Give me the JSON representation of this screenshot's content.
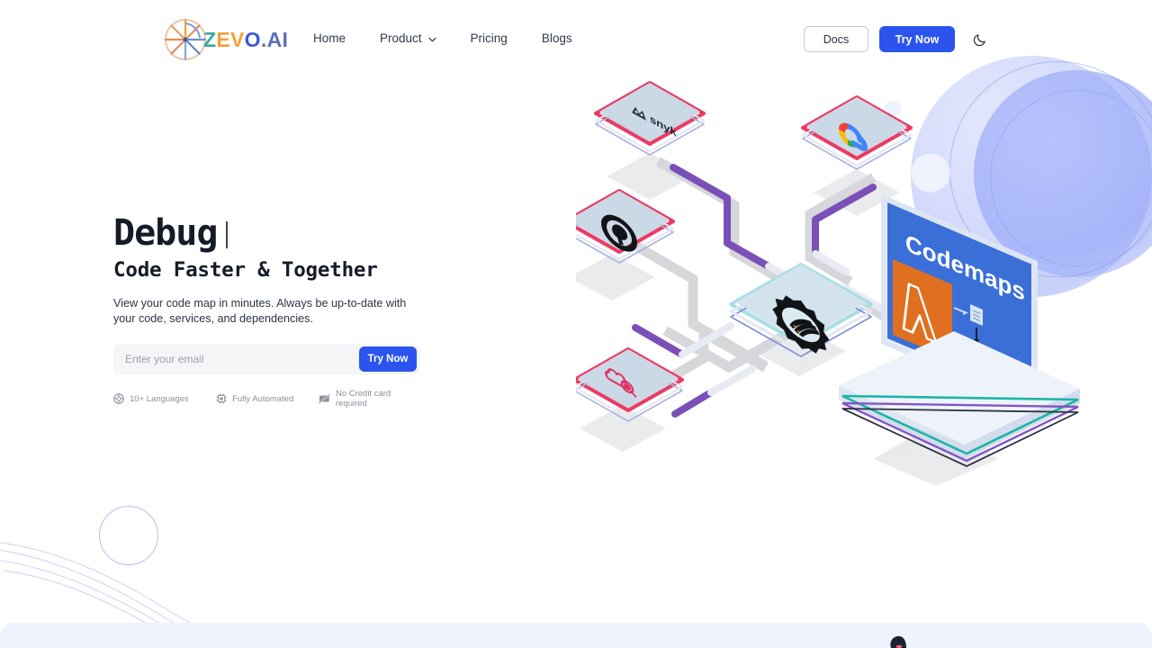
{
  "brand": {
    "name": "ZEVO.AI",
    "logo_icon": "zevo-wheel-logo",
    "parts": {
      "z": "Z",
      "e": "E",
      "v": "V",
      "o": "O",
      "dot": ".",
      "ai": "AI"
    }
  },
  "nav": {
    "links": [
      {
        "label": "Home",
        "has_dropdown": false
      },
      {
        "label": "Product",
        "has_dropdown": true,
        "icon": "chevron-down-icon"
      },
      {
        "label": "Pricing",
        "has_dropdown": false
      },
      {
        "label": "Blogs",
        "has_dropdown": false
      }
    ],
    "docs_label": "Docs",
    "try_now_label": "Try Now",
    "theme_icon": "moon-icon"
  },
  "hero": {
    "headline_typed": "Debug",
    "headline_sub": "Code Faster & Together",
    "subcopy": "View your code map in minutes. Always be up-to-date with your code, services, and dependencies.",
    "email_placeholder": "Enter your email",
    "email_value": "",
    "cta_label": "Try Now",
    "badges": [
      {
        "label": "10+ Languages",
        "icon": "globe-icon"
      },
      {
        "label": "Fully Automated",
        "icon": "chip-icon"
      },
      {
        "label": "No Credit card required",
        "icon": "no-credit-card-icon"
      }
    ]
  },
  "illustration": {
    "screen_title": "Codemaps",
    "cards": [
      {
        "name": "snyk-card",
        "label": "snyk",
        "accent": "#ec3a63"
      },
      {
        "name": "google-cloud-card",
        "label": "Google Cloud",
        "accent": "#ec3a63"
      },
      {
        "name": "github-card",
        "label": "GitHub",
        "accent": "#ec3a63"
      },
      {
        "name": "datadog-card",
        "label": "Datadog",
        "accent": "#ec3a63"
      },
      {
        "name": "gear-card",
        "label": "Build Gear",
        "accent": "#a9dfe4"
      }
    ]
  },
  "colors": {
    "accent_blue": "#2b54ef",
    "card_accent_pink": "#ec3a63",
    "connector_purple": "#7a50b8",
    "screen_blue": "#3a6fd8",
    "lambda_orange": "#e0701f",
    "text_dark": "#151b28",
    "muted": "#8b919e",
    "band": "#eef3fd"
  }
}
